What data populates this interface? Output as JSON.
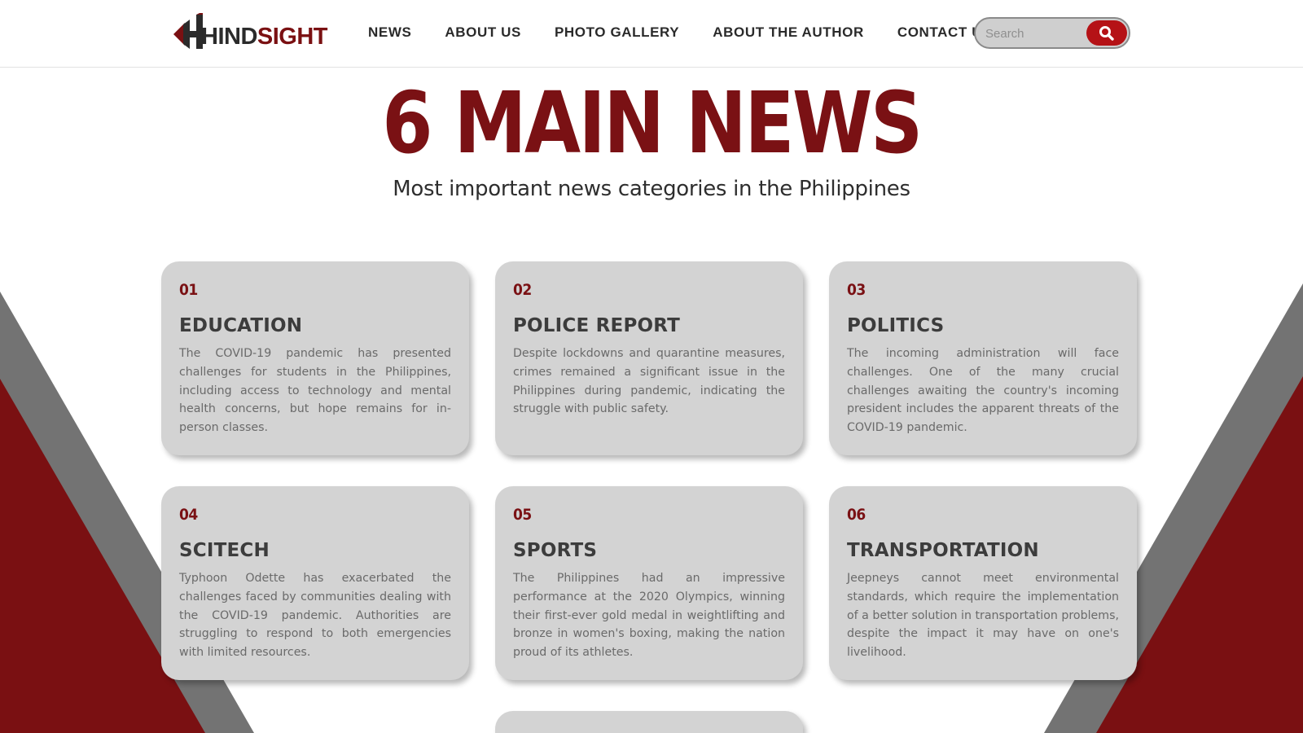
{
  "logo": {
    "text_dark": "HIND",
    "text_red": "SIGHT",
    "leading_letter": "H"
  },
  "nav": [
    "NEWS",
    "ABOUT US",
    "PHOTO GALLERY",
    "ABOUT THE AUTHOR",
    "CONTACT US"
  ],
  "search": {
    "placeholder": "Search",
    "icon": "search-icon"
  },
  "hero": {
    "title": "6 MAIN NEWS",
    "subtitle": "Most important news categories in the Philippines"
  },
  "cards": [
    {
      "num": "01",
      "title": "EDUCATION",
      "text": "The COVID-19 pandemic has presented challenges for students in the Philippines, including access to technology and mental health concerns, but hope remains for in-person classes."
    },
    {
      "num": "02",
      "title": "POLICE REPORT",
      "text": "Despite lockdowns and quarantine measures, crimes remained a significant issue in the Philippines during pandemic, indicating the struggle with public safety."
    },
    {
      "num": "03",
      "title": "POLITICS",
      "text": "The incoming administration will face challenges. One of the many crucial challenges awaiting the country's incoming president includes the apparent threats of the COVID-19 pandemic."
    },
    {
      "num": "04",
      "title": "SCITECH",
      "text": "Typhoon Odette has exacerbated the challenges faced by communities dealing with the COVID-19 pandemic. Authorities are struggling to respond to both emergencies with limited resources."
    },
    {
      "num": "05",
      "title": "SPORTS",
      "text": "The Philippines had an impressive performance at the 2020 Olympics, winning their first-ever gold medal in weightlifting and bronze in women's boxing, making the nation proud of its athletes."
    },
    {
      "num": "06",
      "title": "TRANSPORTATION",
      "text": "Jeepneys cannot meet environmental standards, which require the implementation of a better solution in transportation problems, despite the impact it may have on one's livelihood."
    }
  ],
  "colors": {
    "brand_red": "#7a1114",
    "accent_red": "#b51216",
    "card_bg": "#d3d3d3",
    "wedge_gray": "#737373"
  }
}
